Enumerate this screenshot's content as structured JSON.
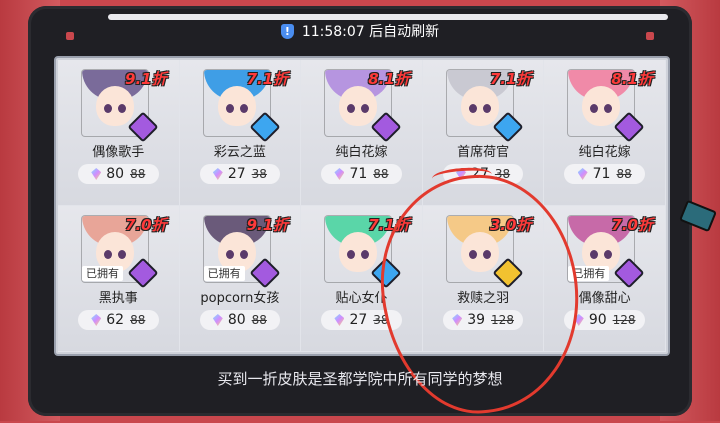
{
  "timer": {
    "icon": "shield-icon",
    "text": "11:58:07 后自动刷新"
  },
  "cards": [
    {
      "name": "偶像歌手",
      "discount": "9.1折",
      "price": "80",
      "old_price": "88",
      "owned": "",
      "badge": "purple",
      "hair": "#7a6b9a"
    },
    {
      "name": "彩云之蓝",
      "discount": "7.1折",
      "price": "27",
      "old_price": "38",
      "owned": "",
      "badge": "blue",
      "hair": "#3f9ee6"
    },
    {
      "name": "纯白花嫁",
      "discount": "8.1折",
      "price": "71",
      "old_price": "88",
      "owned": "",
      "badge": "purple",
      "hair": "#b695e0"
    },
    {
      "name": "首席荷官",
      "discount": "7.1折",
      "price": "27",
      "old_price": "38",
      "owned": "",
      "badge": "blue",
      "hair": "#c9c9d2"
    },
    {
      "name": "纯白花嫁",
      "discount": "8.1折",
      "price": "71",
      "old_price": "88",
      "owned": "",
      "badge": "purple",
      "hair": "#f08aa8"
    },
    {
      "name": "黑执事",
      "discount": "7.0折",
      "price": "62",
      "old_price": "88",
      "owned": "已拥有",
      "badge": "purple",
      "hair": "#e8a598"
    },
    {
      "name": "popcorn女孩",
      "discount": "9.1折",
      "price": "80",
      "old_price": "88",
      "owned": "已拥有",
      "badge": "purple",
      "hair": "#6a5a7a"
    },
    {
      "name": "贴心女仆",
      "discount": "7.1折",
      "price": "27",
      "old_price": "38",
      "owned": "",
      "badge": "blue",
      "hair": "#5ad6a8"
    },
    {
      "name": "救赎之羽",
      "discount": "3.0折",
      "price": "39",
      "old_price": "128",
      "owned": "",
      "badge": "gold",
      "hair": "#f5c987"
    },
    {
      "name": "偶像甜心",
      "discount": "7.0折",
      "price": "90",
      "old_price": "128",
      "owned": "已拥有",
      "badge": "purple",
      "hair": "#c76aa8"
    }
  ],
  "footer": "买到一折皮肤是圣都学院中所有同学的梦想",
  "colors": {
    "discount": "#ff3a3a",
    "annotation": "#e23a2e",
    "background": "#c9474d"
  }
}
